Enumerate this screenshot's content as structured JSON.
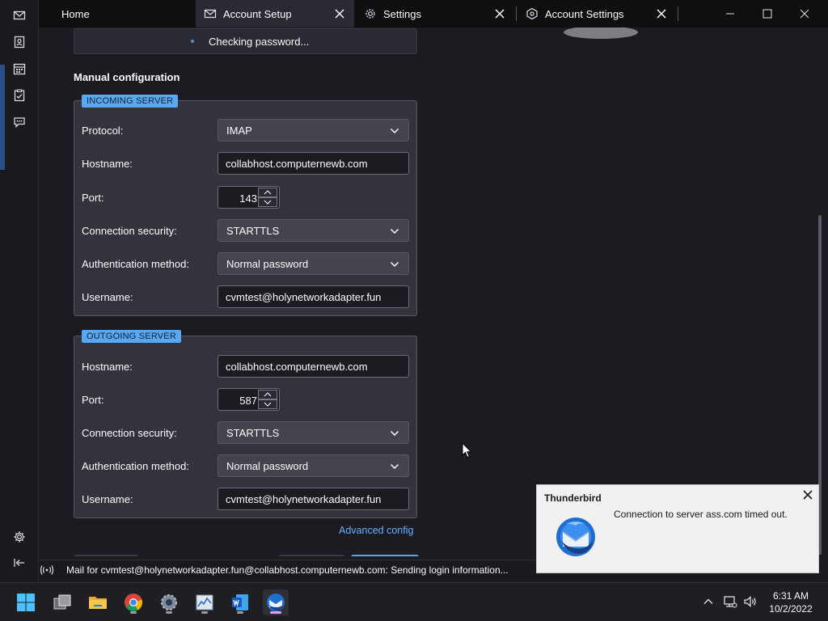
{
  "tabs": [
    {
      "label": "Home"
    },
    {
      "label": "Account Setup"
    },
    {
      "label": "Settings"
    },
    {
      "label": "Account Settings"
    }
  ],
  "notification": {
    "text": "Checking password..."
  },
  "manual_config": {
    "title": "Manual configuration"
  },
  "incoming": {
    "legend": "INCOMING SERVER",
    "protocol_label": "Protocol:",
    "protocol_value": "IMAP",
    "hostname_label": "Hostname:",
    "hostname_value": "collabhost.computernewb.com",
    "port_label": "Port:",
    "port_value": "143",
    "security_label": "Connection security:",
    "security_value": "STARTTLS",
    "auth_label": "Authentication method:",
    "auth_value": "Normal password",
    "username_label": "Username:",
    "username_value": "cvmtest@holynetworkadapter.fun"
  },
  "outgoing": {
    "legend": "OUTGOING SERVER",
    "hostname_label": "Hostname:",
    "hostname_value": "collabhost.computernewb.com",
    "port_label": "Port:",
    "port_value": "587",
    "security_label": "Connection security:",
    "security_value": "STARTTLS",
    "auth_label": "Authentication method:",
    "auth_value": "Normal password",
    "username_label": "Username:",
    "username_value": "cvmtest@holynetworkadapter.fun"
  },
  "advanced_config": "Advanced config",
  "status_bar": {
    "text": "Mail for cvmtest@holynetworkadapter.fun@collabhost.computernewb.com: Sending login information..."
  },
  "toast": {
    "title": "Thunderbird",
    "message": "Connection to server ass.com timed out."
  },
  "clock": {
    "time": "6:31 AM",
    "date": "10/2/2022"
  },
  "colors": {
    "accent": "#5aa7ef",
    "link": "#64b0ff",
    "background": "#1c1b22",
    "fieldset": "#34333b"
  },
  "icons": {
    "spaces": [
      "mail-icon",
      "address-book-icon",
      "calendar-icon",
      "tasks-icon",
      "chat-icon",
      "settings-icon",
      "collapse-icon"
    ],
    "taskbar": [
      "windows-start-icon",
      "file-explorer-icon",
      "folder-icon",
      "chrome-icon",
      "settings-app-icon",
      "task-manager-icon",
      "word-icon",
      "thunderbird-icon"
    ]
  }
}
